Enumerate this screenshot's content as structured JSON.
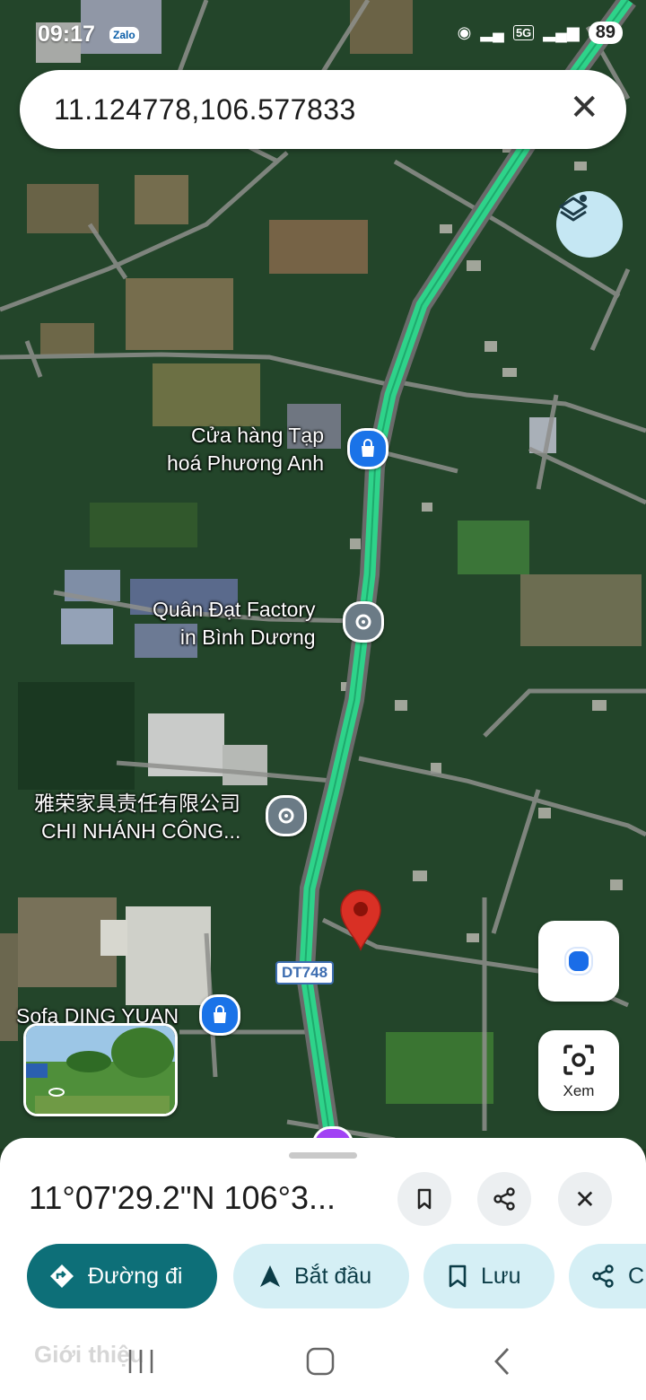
{
  "status_bar": {
    "time": "09:17",
    "app_badge": "Zalo",
    "network": "5G",
    "battery": "89"
  },
  "search": {
    "query": "11.124778,106.577833"
  },
  "map": {
    "pois": [
      {
        "line1": "Cửa hàng Tạp",
        "line2": "hoá Phương Anh",
        "icon": "shopping-bag-icon",
        "color": "#1a73e8"
      },
      {
        "line1": "Quân Đạt Factory",
        "line2": "in Bình Dương",
        "icon": "place-icon",
        "color": "#6b7b86"
      },
      {
        "line1": "雅荣家具责任有限公司",
        "line2": "CHI NHÁNH CÔNG...",
        "icon": "place-icon",
        "color": "#6b7b86"
      },
      {
        "line1": "Sofa DING YUAN",
        "line2": "",
        "icon": "shopping-bag-icon",
        "color": "#1a73e8"
      }
    ],
    "road_shield": "DT748",
    "dropped_pin_color": "#d93025",
    "route_color": "#2ed38a"
  },
  "controls": {
    "camera_label": "Xem"
  },
  "sheet": {
    "coordinates": "11°07'29.2\"N 106°3...",
    "chips": [
      {
        "label": "Đường đi",
        "icon": "directions-icon"
      },
      {
        "label": "Bắt đầu",
        "icon": "navigation-arrow-icon"
      },
      {
        "label": "Lưu",
        "icon": "bookmark-icon"
      },
      {
        "label": "C",
        "icon": "share-icon"
      }
    ],
    "intro_tab": "Giới thiệu"
  }
}
